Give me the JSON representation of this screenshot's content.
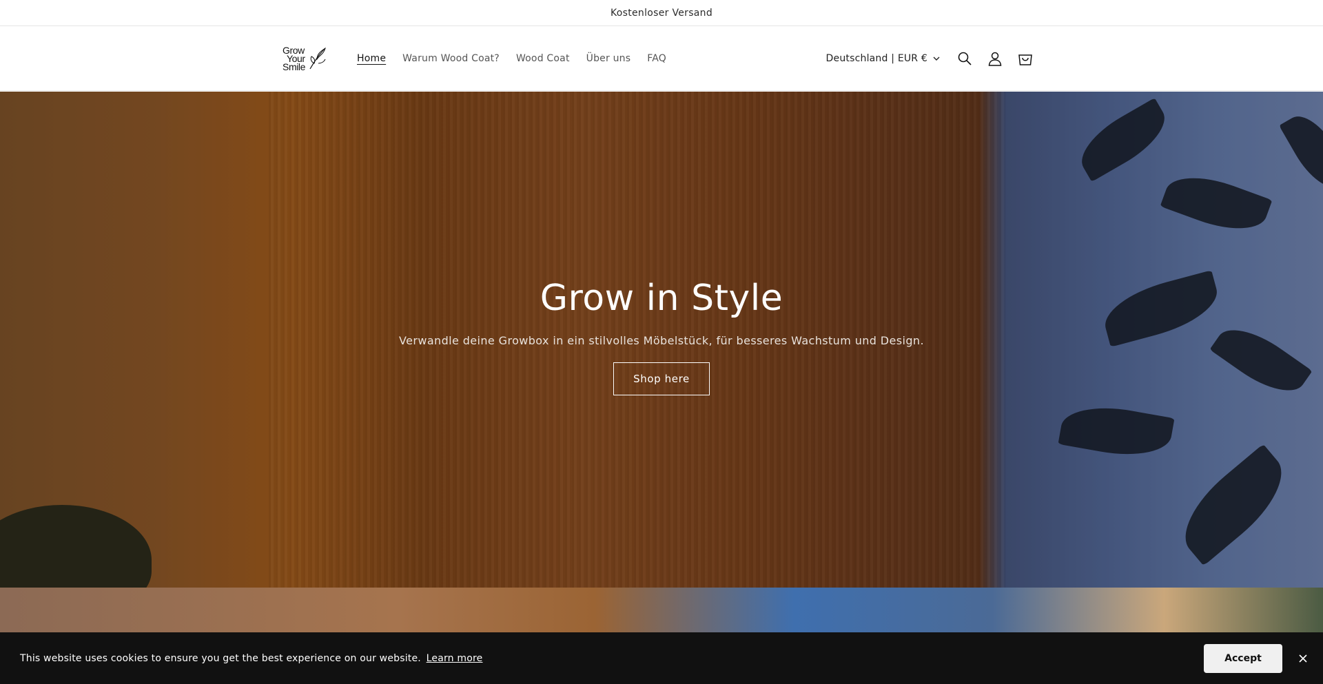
{
  "announcement": {
    "text": "Kostenloser Versand"
  },
  "header": {
    "logo": {
      "line1": "Grow",
      "line2": "Your",
      "line3": "Smile"
    },
    "nav": [
      {
        "label": "Home",
        "active": true
      },
      {
        "label": "Warum Wood Coat?",
        "active": false
      },
      {
        "label": "Wood Coat",
        "active": false
      },
      {
        "label": "Über uns",
        "active": false
      },
      {
        "label": "FAQ",
        "active": false
      }
    ],
    "country_selector": "Deutschland | EUR €",
    "icons": [
      "search-icon",
      "account-icon",
      "cart-icon"
    ]
  },
  "hero": {
    "title": "Grow in Style",
    "subtitle": "Verwandle deine Growbox in ein stilvolles Möbelstück, für besseres Wachstum und Design.",
    "button": "Shop here"
  },
  "cookie_banner": {
    "text": "This website uses cookies to ensure you get the best experience on our website.",
    "learn_more": "Learn more",
    "accept": "Accept"
  },
  "colors": {
    "text": "#121212",
    "cookie_bg": "#111111",
    "accept_bg": "#f0f0f0"
  }
}
